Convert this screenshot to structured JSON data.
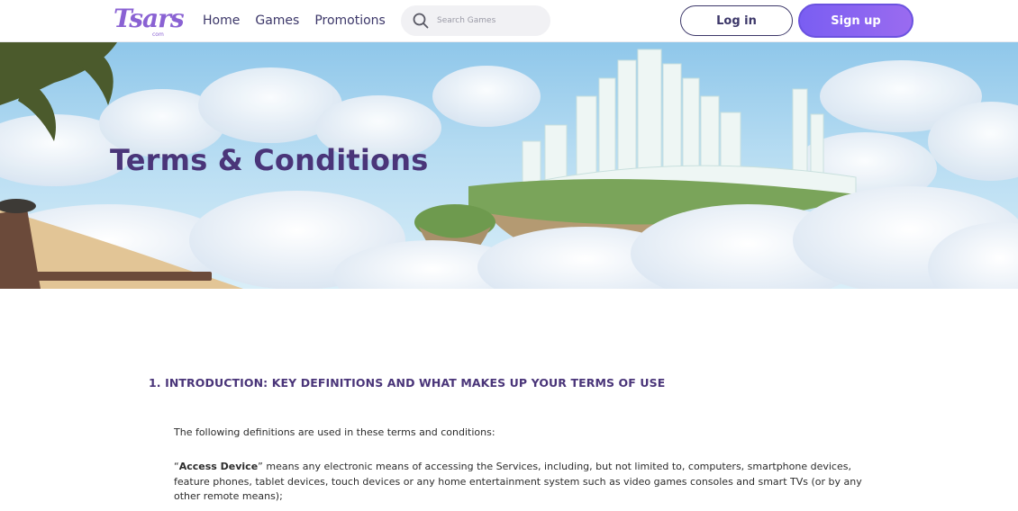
{
  "header": {
    "logo_text": "Tsars",
    "logo_sub": "com",
    "nav": [
      {
        "label": "Home"
      },
      {
        "label": "Games"
      },
      {
        "label": "Promotions"
      }
    ],
    "search": {
      "placeholder": "Search Games",
      "icon": "search-icon"
    },
    "login_label": "Log in",
    "signup_label": "Sign up"
  },
  "hero": {
    "title": "Terms & Conditions"
  },
  "content": {
    "section_heading": "1. INTRODUCTION: KEY DEFINITIONS AND WHAT MAKES UP YOUR TERMS OF USE",
    "intro": "The following definitions are used in these terms and conditions:",
    "definition_open_quote": "“",
    "definition_term": "Access Device",
    "definition_text": "” means any electronic means of accessing the Services, including, but not limited to, computers, smartphone devices, feature phones, tablet devices, touch devices or any home entertainment system such as video games consoles and smart TVs (or by any other remote means);"
  },
  "colors": {
    "brand_purple": "#4a3579",
    "accent_violet": "#8a62d3",
    "signup_gradient_start": "#7a5ef2",
    "signup_gradient_end": "#9a6bf0"
  }
}
